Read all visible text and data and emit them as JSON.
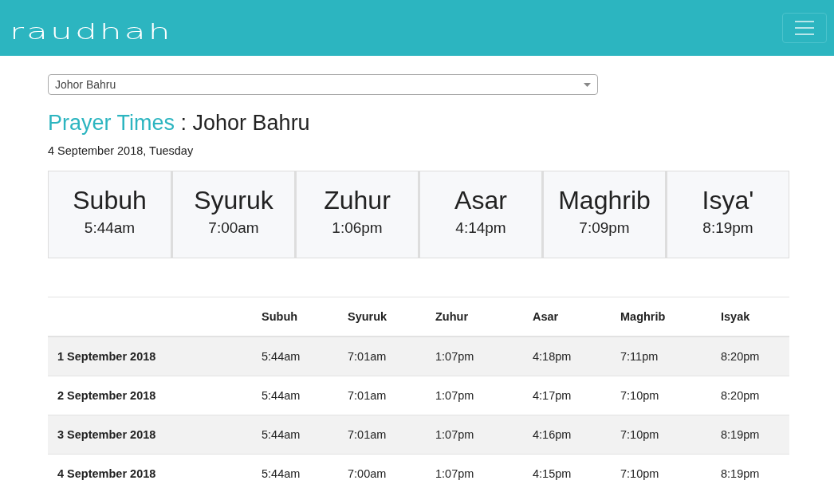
{
  "header": {
    "logo": "raudhah"
  },
  "zone_select": {
    "value": "Johor Bahru"
  },
  "heading": {
    "accent": "Prayer Times",
    "rest": " : Johor Bahru"
  },
  "date": "4 September 2018, Tuesday",
  "today": [
    {
      "name": "Subuh",
      "time": "5:44am"
    },
    {
      "name": "Syuruk",
      "time": "7:00am"
    },
    {
      "name": "Zuhur",
      "time": "1:06pm"
    },
    {
      "name": "Asar",
      "time": "4:14pm"
    },
    {
      "name": "Maghrib",
      "time": "7:09pm"
    },
    {
      "name": "Isya'",
      "time": "8:19pm"
    }
  ],
  "table": {
    "columns": [
      "",
      "Subuh",
      "Syuruk",
      "Zuhur",
      "Asar",
      "Maghrib",
      "Isyak"
    ],
    "rows": [
      [
        "1 September 2018",
        "5:44am",
        "7:01am",
        "1:07pm",
        "4:18pm",
        "7:11pm",
        "8:20pm"
      ],
      [
        "2 September 2018",
        "5:44am",
        "7:01am",
        "1:07pm",
        "4:17pm",
        "7:10pm",
        "8:20pm"
      ],
      [
        "3 September 2018",
        "5:44am",
        "7:01am",
        "1:07pm",
        "4:16pm",
        "7:10pm",
        "8:19pm"
      ],
      [
        "4 September 2018",
        "5:44am",
        "7:00am",
        "1:07pm",
        "4:15pm",
        "7:10pm",
        "8:19pm"
      ]
    ]
  }
}
